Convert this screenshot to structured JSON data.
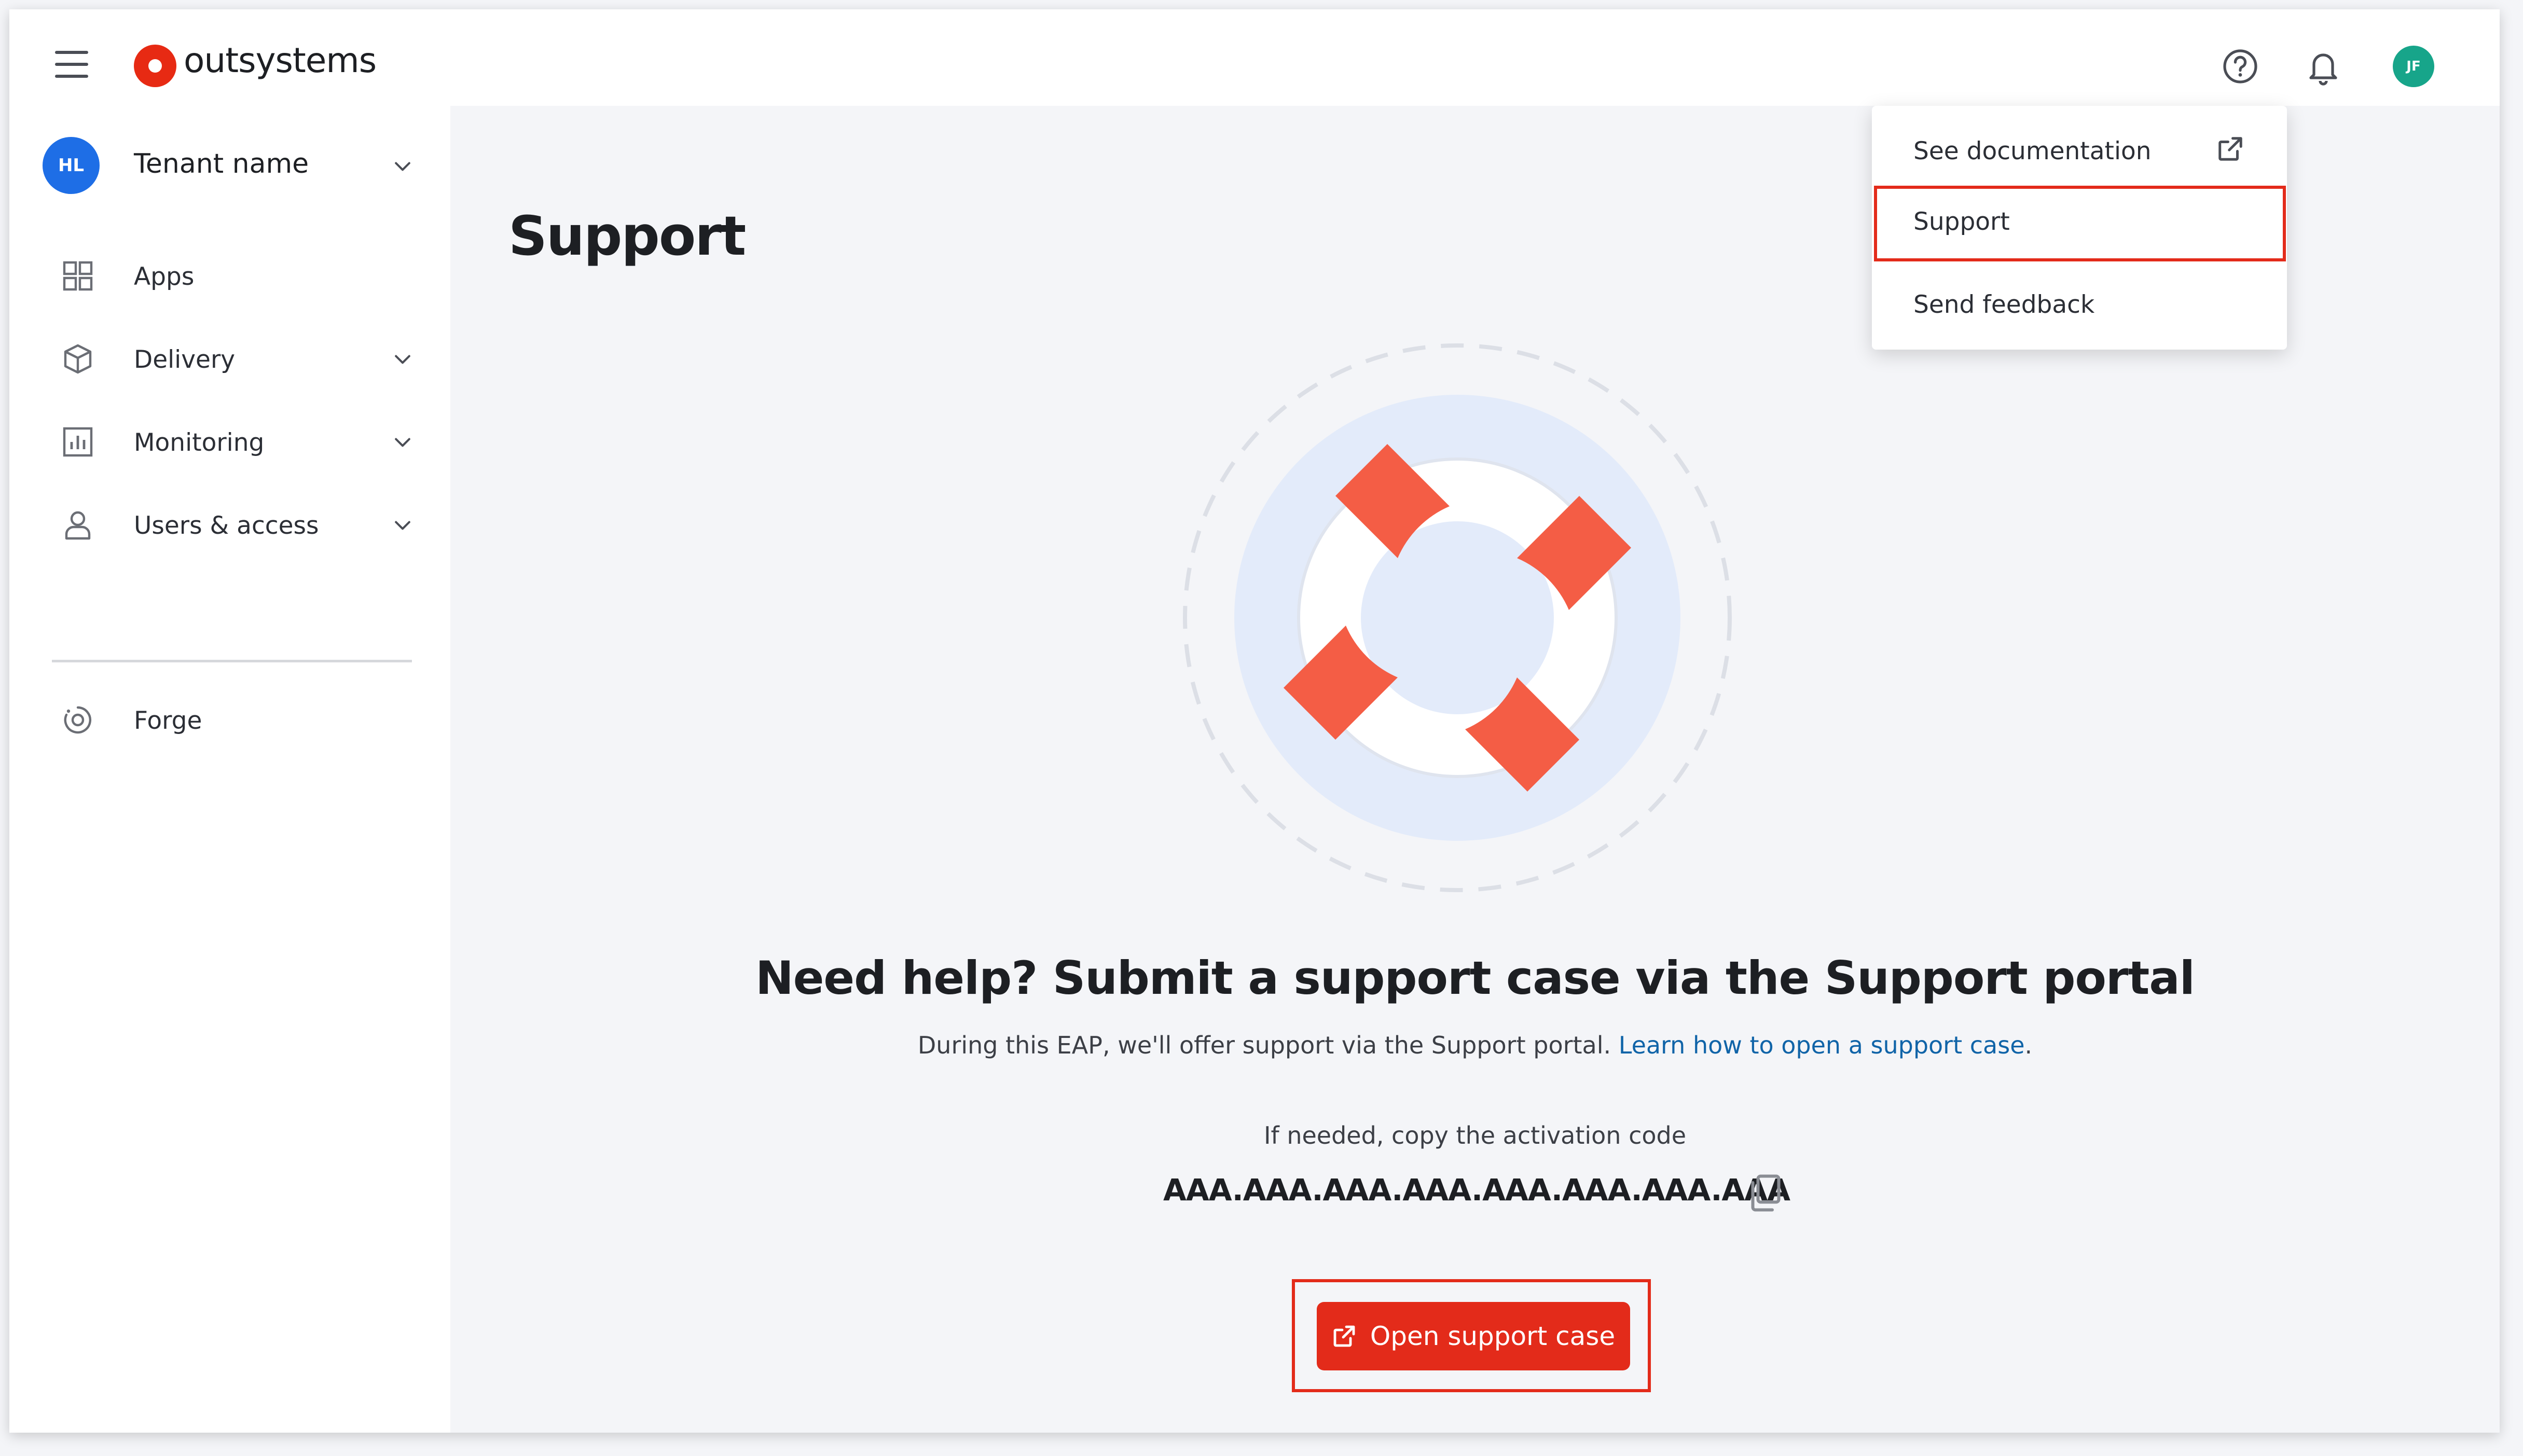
{
  "app": {
    "brand": "outsystems"
  },
  "header": {
    "avatar_initials": "JF",
    "icons": [
      "menu-icon",
      "help-icon",
      "bell-icon"
    ]
  },
  "sidebar": {
    "tenant": {
      "initials": "HL",
      "name": "Tenant name"
    },
    "items": [
      {
        "label": "Apps",
        "icon": "grid-icon",
        "expandable": false
      },
      {
        "label": "Delivery",
        "icon": "box-icon",
        "expandable": true
      },
      {
        "label": "Monitoring",
        "icon": "chart-icon",
        "expandable": true
      },
      {
        "label": "Users & access",
        "icon": "user-icon",
        "expandable": true
      },
      {
        "label": "Forge",
        "icon": "forge-icon",
        "expandable": false
      }
    ]
  },
  "main": {
    "title": "Support",
    "headline": "Need help? Submit a support case via the Support portal",
    "sub_text": "During this EAP, we'll offer support via the Support portal. ",
    "sub_link": "Learn how to open a support case",
    "sub_end": ".",
    "copy_hint": "If needed, copy the activation code",
    "activation_code": "AAA.AAA.AAA.AAA.AAA.AAA.AAA.AAA",
    "cta_label": "Open support case"
  },
  "help_menu": {
    "items": [
      {
        "label": "See documentation",
        "external": true
      },
      {
        "label": "Support",
        "highlighted": true
      },
      {
        "label": "Send feedback"
      }
    ]
  },
  "colors": {
    "brand_red": "#e32b1a",
    "lifebuoy_red": "#f45d45",
    "link_blue": "#1064a8",
    "tenant_blue": "#1e6ee6",
    "avatar_teal": "#17a58a"
  }
}
